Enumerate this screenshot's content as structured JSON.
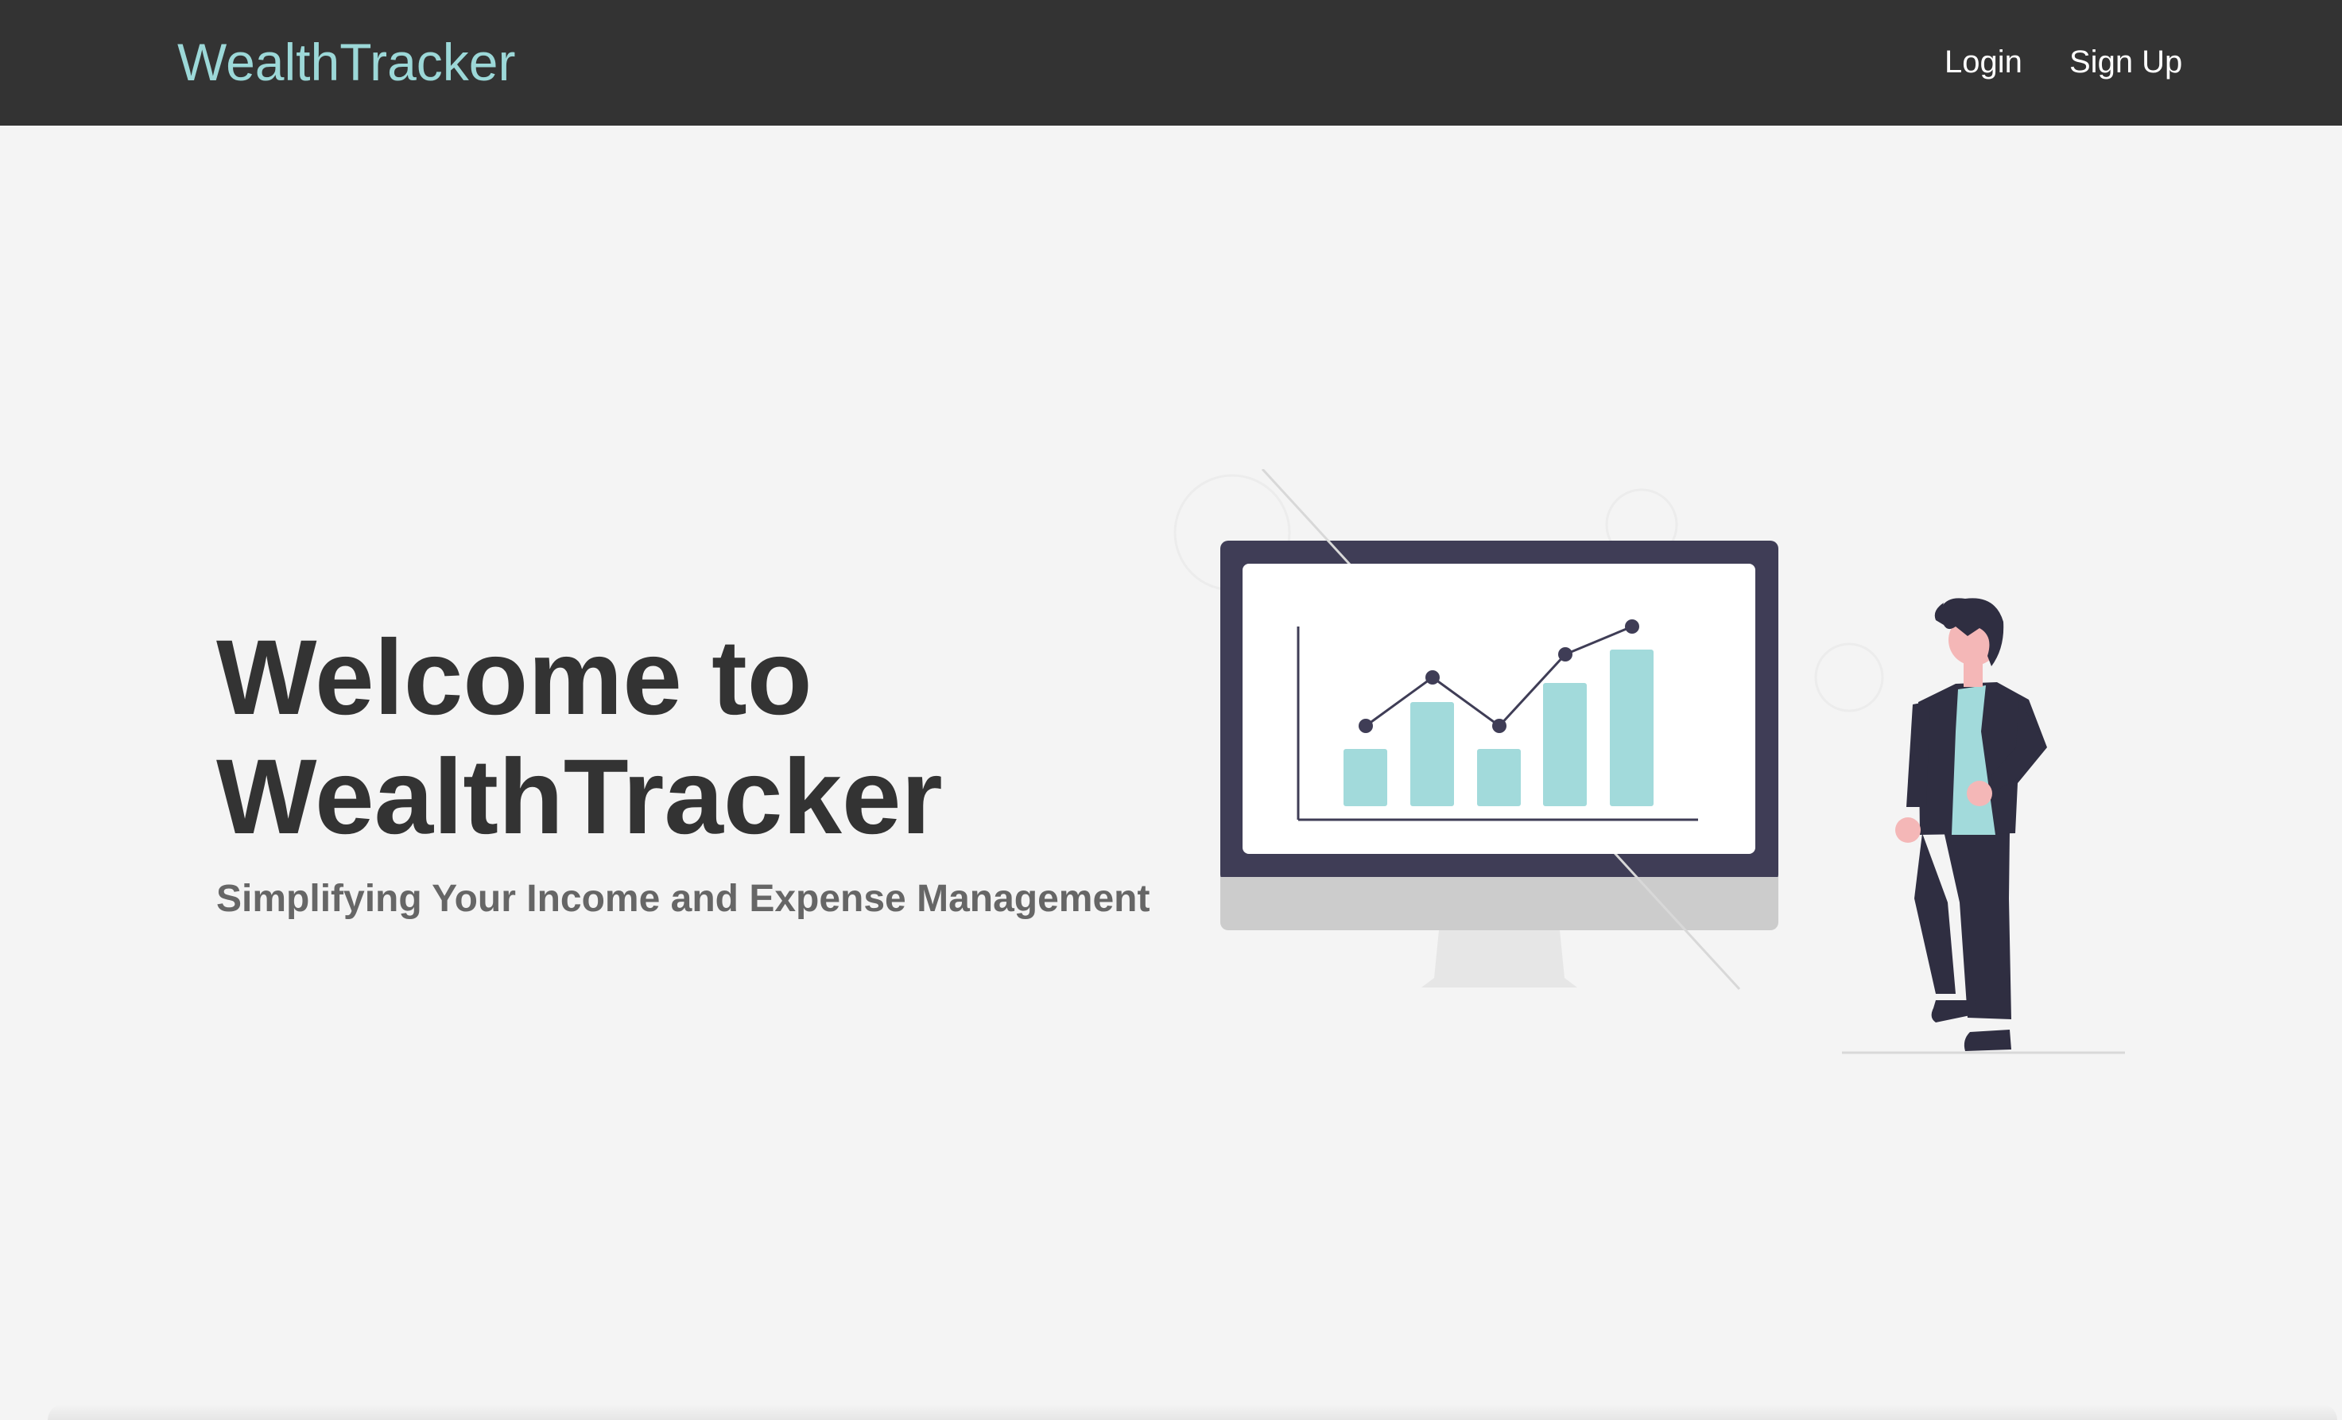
{
  "nav": {
    "brand": "WealthTracker",
    "links": [
      {
        "label": "Login"
      },
      {
        "label": "Sign Up"
      }
    ]
  },
  "hero": {
    "title_line1": "Welcome to",
    "title_line2": "WealthTracker",
    "subtitle": "Simplifying Your Income and Expense Management"
  },
  "colors": {
    "navbar_bg": "#333333",
    "brand": "#9cd8d8",
    "accent": "#a2dadb",
    "monitor_frame": "#3f3d56",
    "page_bg": "#f4f4f4",
    "title_text": "#333333",
    "subtitle_text": "#666666"
  }
}
